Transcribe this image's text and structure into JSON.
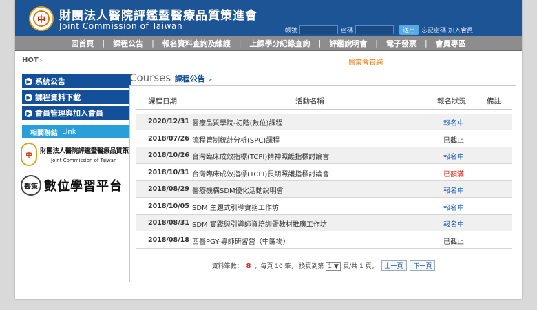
{
  "header": {
    "org_name": "財團法人醫院評鑑暨醫療品質策進會",
    "org_en": "Joint Commission of Taiwan",
    "logo_mark": "中",
    "login": {
      "account_label": "帳號",
      "password_label": "密碼",
      "submit_label": "送出",
      "forgot_label": "忘記密碼",
      "divider": "|",
      "join_label": "加入會員"
    }
  },
  "nav": {
    "items": [
      "回首頁",
      "課程公告",
      "報名資料查詢及維護",
      "上課學分紀錄查詢",
      "評鑑說明會",
      "電子發票",
      "會員專區"
    ],
    "separator": "|"
  },
  "hot": {
    "label": "HOT",
    "chevron": "›"
  },
  "top_link": "醫策會官網",
  "sidebar": {
    "items": [
      {
        "label": "系統公告"
      },
      {
        "label": "課程資料下載"
      },
      {
        "label": "會員管理與加入會員"
      }
    ],
    "related": {
      "zh": "相關聯結",
      "en": "Link"
    },
    "logo1": {
      "mark": "中",
      "zh": "財團法人醫院評鑑暨醫療品質策進會",
      "en": "Joint Commission of Taiwan"
    },
    "logo2": {
      "mark": "醫策",
      "text": "數位學習平台"
    }
  },
  "main": {
    "title": "Courses",
    "subtitle": "課程公告",
    "subtitle_chevron": "»",
    "columns": {
      "date": "課程日期",
      "name": "活動名稱",
      "status": "報名狀況",
      "note": "備註"
    },
    "rows": [
      {
        "date": "2020/12/31",
        "name": "醫療品質學院-初階(數位)課程",
        "status": "報名中",
        "status_color": "#1d5fb8"
      },
      {
        "date": "2018/07/26",
        "name": "流程管制統計分析(SPC)課程",
        "status": "已截止",
        "status_color": "#333333"
      },
      {
        "date": "2018/10/26",
        "name": "台灣臨床成效指標(TCPI)精神照護指標討論會",
        "status": "報名中",
        "status_color": "#1d5fb8"
      },
      {
        "date": "2018/10/31",
        "name": "台灣臨床成效指標(TCPI)長期照護指標討論會",
        "status": "已額滿",
        "status_color": "#d9261c"
      },
      {
        "date": "2018/08/29",
        "name": "醫療機構SDM優化活動說明會",
        "status": "報名中",
        "status_color": "#1d5fb8"
      },
      {
        "date": "2018/10/05",
        "name": "SDM 主題式引導實務工作坊",
        "status": "報名中",
        "status_color": "#1d5fb8"
      },
      {
        "date": "2018/08/31",
        "name": "SDM 實踐與引導師資培訓暨教材推廣工作坊",
        "status": "報名中",
        "status_color": "#1d5fb8"
      },
      {
        "date": "2018/08/18",
        "name": "西醫PGY-導師研習營（中區場）",
        "status": "已截止",
        "status_color": "#333333"
      }
    ],
    "pager": {
      "count_label": "資料筆數：",
      "count": "8",
      "per_page_text": "，每頁 10 筆，",
      "goto_label": "換頁到第",
      "current_page": "1",
      "dropdown": "▼",
      "total_text": "頁/共 1 頁，",
      "prev_label": "上一頁",
      "next_label": "下一頁"
    }
  },
  "colors": {
    "header_bg": "#1c5496",
    "nav_bg": "#8d8d8d",
    "sidebar_bg": "#14509a",
    "related_bg": "#2a9ed8",
    "top_link": "#e87a12"
  }
}
